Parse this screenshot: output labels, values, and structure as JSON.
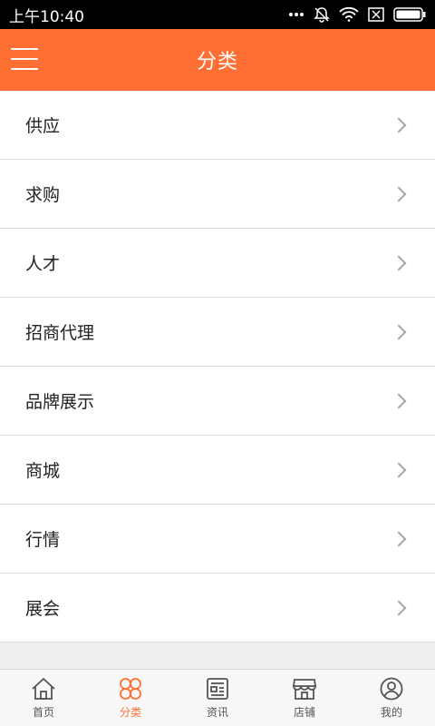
{
  "status": {
    "time": "上午10:40",
    "icons": [
      "more-icon",
      "mute-icon",
      "wifi-icon",
      "sim-icon",
      "battery-icon"
    ]
  },
  "header": {
    "title": "分类",
    "menu_icon": "menu-icon"
  },
  "categories": [
    "供应",
    "求购",
    "人才",
    "招商代理",
    "品牌展示",
    "商城",
    "行情",
    "展会"
  ],
  "tabs": [
    {
      "label": "首页",
      "icon": "home-icon",
      "active": false
    },
    {
      "label": "分类",
      "icon": "category-icon",
      "active": true
    },
    {
      "label": "资讯",
      "icon": "news-icon",
      "active": false
    },
    {
      "label": "店铺",
      "icon": "store-icon",
      "active": false
    },
    {
      "label": "我的",
      "icon": "profile-icon",
      "active": false
    }
  ],
  "colors": {
    "accent": "#ff6f33",
    "status_bar": "#000000",
    "tab_inactive": "#555555"
  }
}
